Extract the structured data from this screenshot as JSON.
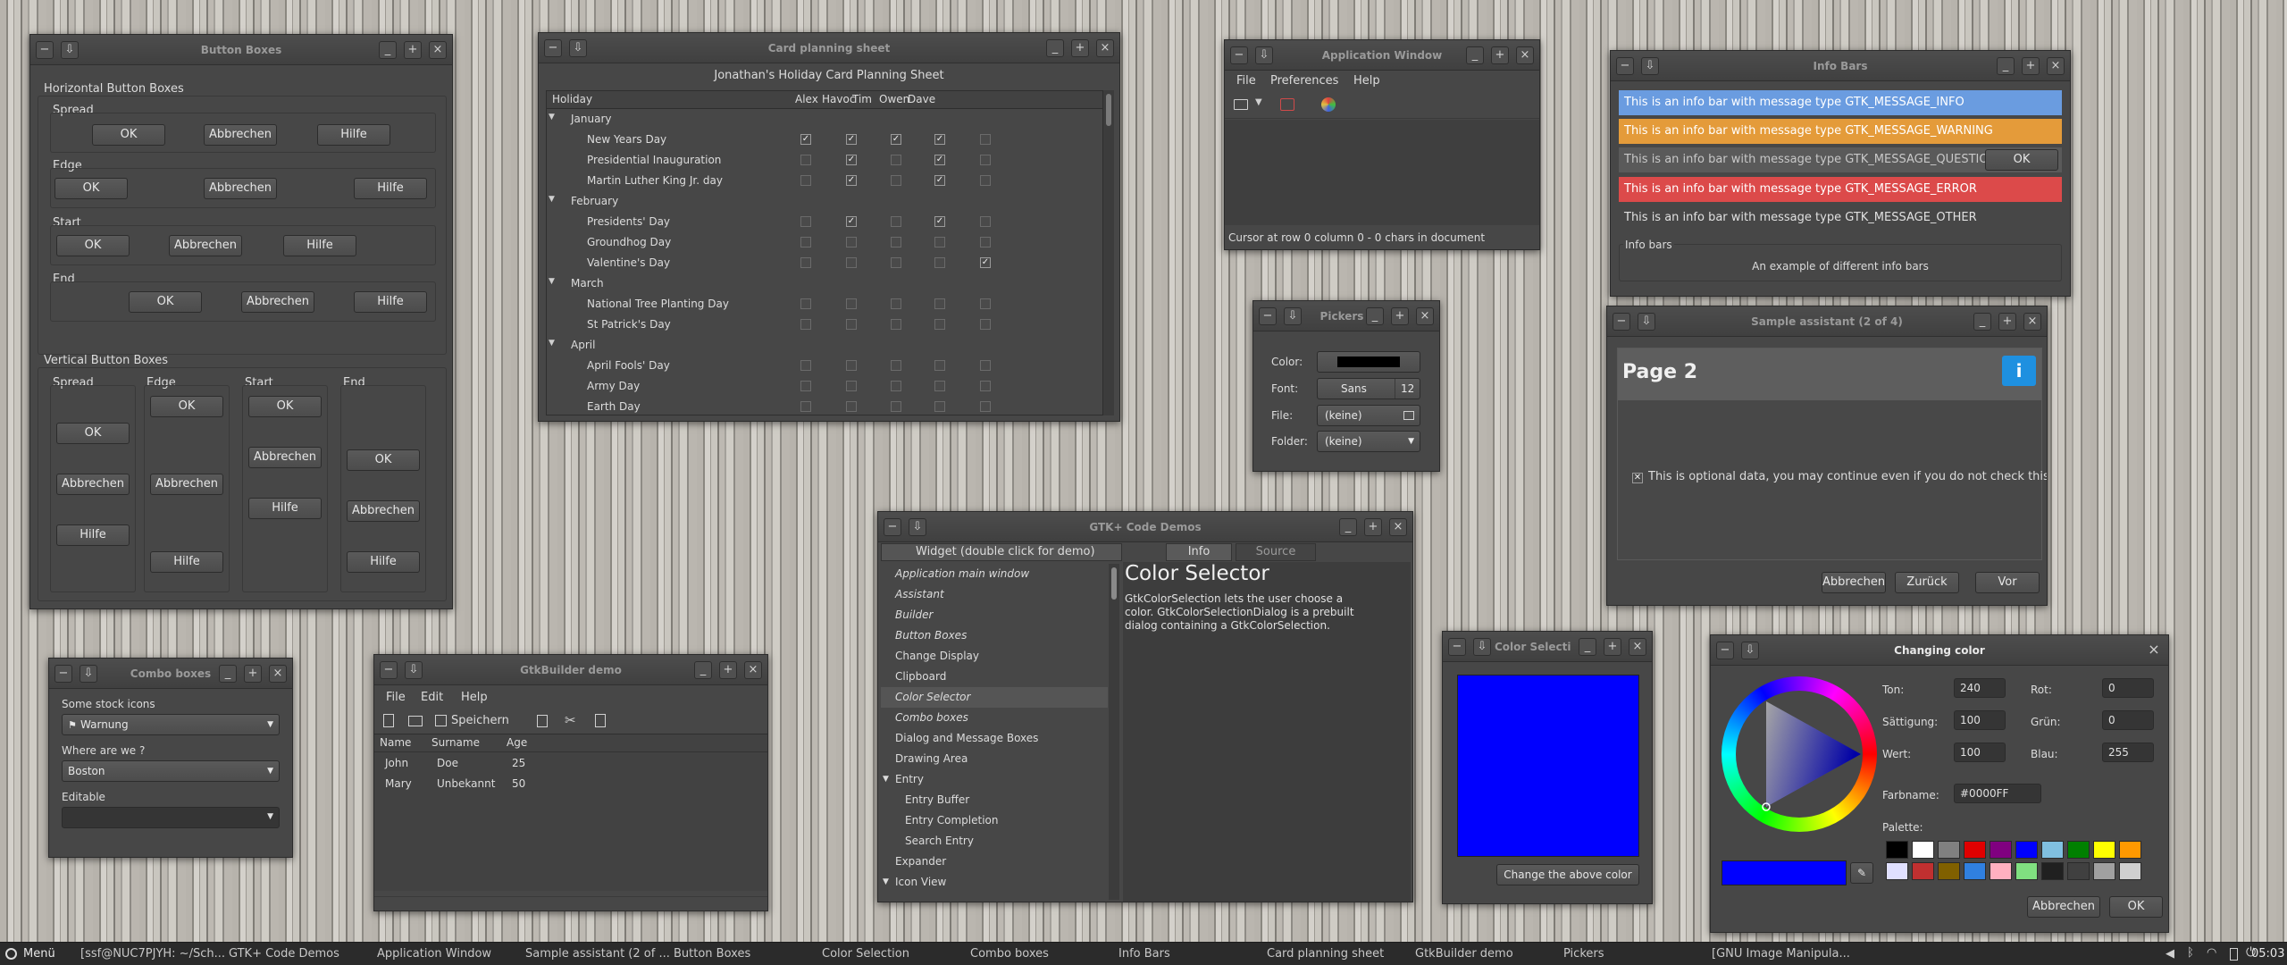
{
  "button_boxes": {
    "title": "Button Boxes",
    "horizontal": "Horizontal Button Boxes",
    "vertical": "Vertical Button Boxes",
    "spread": "Spread",
    "edge": "Edge",
    "start": "Start",
    "end": "End",
    "ok": "OK",
    "abbrechen": "Abbrechen",
    "hilfe": "Hilfe"
  },
  "card_planning": {
    "title": "Card planning sheet",
    "heading": "Jonathan's Holiday Card Planning Sheet",
    "columns": [
      "Holiday",
      "Alex",
      "Havoc",
      "Tim",
      "Owen",
      "Dave"
    ],
    "rows": [
      {
        "label": "January",
        "group": true
      },
      {
        "label": "New Years Day",
        "checks": [
          1,
          1,
          1,
          1,
          0
        ]
      },
      {
        "label": "Presidential Inauguration",
        "checks": [
          0,
          1,
          0,
          1,
          0
        ]
      },
      {
        "label": "Martin Luther King Jr. day",
        "checks": [
          0,
          1,
          0,
          1,
          0
        ]
      },
      {
        "label": "February",
        "group": true
      },
      {
        "label": "Presidents' Day",
        "checks": [
          0,
          1,
          0,
          1,
          0
        ]
      },
      {
        "label": "Groundhog Day",
        "checks": [
          0,
          0,
          0,
          0,
          0
        ]
      },
      {
        "label": "Valentine's Day",
        "checks": [
          0,
          0,
          0,
          0,
          1
        ]
      },
      {
        "label": "March",
        "group": true
      },
      {
        "label": "National Tree Planting Day",
        "checks": [
          0,
          0,
          0,
          0,
          0
        ]
      },
      {
        "label": "St Patrick's Day",
        "checks": [
          0,
          0,
          0,
          0,
          0
        ]
      },
      {
        "label": "April",
        "group": true
      },
      {
        "label": "April Fools' Day",
        "checks": [
          0,
          0,
          0,
          0,
          0
        ]
      },
      {
        "label": "Army Day",
        "checks": [
          0,
          0,
          0,
          0,
          0
        ]
      },
      {
        "label": "Earth Day",
        "checks": [
          0,
          0,
          0,
          0,
          0
        ]
      }
    ]
  },
  "app_window": {
    "title": "Application Window",
    "menu": [
      "File",
      "Preferences",
      "Help"
    ],
    "status": "Cursor at row 0 column 0 - 0 chars in document"
  },
  "pickers": {
    "title": "Pickers",
    "color_label": "Color:",
    "font_label": "Font:",
    "font_name": "Sans",
    "font_size": "12",
    "file_label": "File:",
    "file_value": "(keine)",
    "folder_label": "Folder:",
    "folder_value": "(keine)"
  },
  "info_bars": {
    "title": "Info Bars",
    "bars": [
      {
        "text": "This is an info bar with message type GTK_MESSAGE_INFO",
        "color": "#6a9ce0"
      },
      {
        "text": "This is an info bar with message type GTK_MESSAGE_WARNING",
        "color": "#e49b3a"
      },
      {
        "text": "This is an info bar with message type GTK_MESSAGE_QUESTION",
        "color": "#5a5a5a"
      },
      {
        "text": "This is an info bar with message type GTK_MESSAGE_ERROR",
        "color": "#dc4a4a"
      },
      {
        "text": "This is an info bar with message type GTK_MESSAGE_OTHER",
        "color": "#474747"
      }
    ],
    "ok": "OK",
    "frame_label": "Info bars",
    "frame_text": "An example of different info bars"
  },
  "assistant": {
    "title": "Sample assistant (2 of 4)",
    "page": "Page 2",
    "check_text": "This is optional data, you may continue even if you do not check this",
    "abbrechen": "Abbrechen",
    "zuruck": "Zurück",
    "vor": "Vor"
  },
  "code_demos": {
    "title": "GTK+ Code Demos",
    "col_header": "Widget (double click for demo)",
    "tab_info": "Info",
    "tab_source": "Source",
    "items": [
      {
        "label": "Application main window",
        "italic": true,
        "indent": 0
      },
      {
        "label": "Assistant",
        "italic": true,
        "indent": 0
      },
      {
        "label": "Builder",
        "italic": true,
        "indent": 0
      },
      {
        "label": "Button Boxes",
        "italic": true,
        "indent": 0
      },
      {
        "label": "Change Display",
        "italic": false,
        "indent": 0
      },
      {
        "label": "Clipboard",
        "italic": false,
        "indent": 0
      },
      {
        "label": "Color Selector",
        "italic": true,
        "indent": 0,
        "selected": true
      },
      {
        "label": "Combo boxes",
        "italic": true,
        "indent": 0
      },
      {
        "label": "Dialog and Message Boxes",
        "italic": false,
        "indent": 0
      },
      {
        "label": "Drawing Area",
        "italic": false,
        "indent": 0
      },
      {
        "label": "Entry",
        "italic": false,
        "indent": 0,
        "expander": true
      },
      {
        "label": "Entry Buffer",
        "italic": false,
        "indent": 1
      },
      {
        "label": "Entry Completion",
        "italic": false,
        "indent": 1
      },
      {
        "label": "Search Entry",
        "italic": false,
        "indent": 1
      },
      {
        "label": "Expander",
        "italic": false,
        "indent": 0
      },
      {
        "label": "Icon View",
        "italic": false,
        "indent": 0,
        "expander": true
      }
    ],
    "info_title": "Color Selector",
    "info_text": "GtkColorSelection lets the user choose a color. GtkColorSelectionDialog is a prebuilt dialog containing a GtkColorSelection."
  },
  "combo_boxes": {
    "title": "Combo boxes",
    "stock_label": "Some stock icons",
    "stock_value": "Warnung",
    "where_label": "Where are we ?",
    "where_value": "Boston",
    "editable_label": "Editable"
  },
  "gtkbuilder": {
    "title": "GtkBuilder demo",
    "menu": [
      "File",
      "Edit",
      "Help"
    ],
    "save": "Speichern",
    "columns": [
      "Name",
      "Surname",
      "Age"
    ],
    "rows": [
      [
        "John",
        "Doe",
        "25"
      ],
      [
        "Mary",
        "Unbekannt",
        "50"
      ]
    ]
  },
  "color_selection": {
    "title": "Color Selecti",
    "button": "Change the above color",
    "color": "#0000FF"
  },
  "changing_color": {
    "title": "Changing color",
    "ton_label": "Ton:",
    "ton": "240",
    "sat_label": "Sättigung:",
    "sat": "100",
    "wert_label": "Wert:",
    "wert": "100",
    "rot_label": "Rot:",
    "rot": "0",
    "grun_label": "Grün:",
    "grun": "0",
    "blau_label": "Blau:",
    "blau": "255",
    "farbname_label": "Farbname:",
    "farbname": "#0000FF",
    "palette_label": "Palette:",
    "abbrechen": "Abbrechen",
    "ok": "OK",
    "palette": [
      "#000000",
      "#ffffff",
      "#808080",
      "#e00000",
      "#800080",
      "#0000ff",
      "#80c0e0",
      "#008000",
      "#ffff00",
      "#ff9900",
      "#e0e0ff",
      "#c03030",
      "#806000",
      "#3080e0",
      "#ffb0c0",
      "#80e080",
      "#202020",
      "#404040",
      "#a0a0a0",
      "#d0d0d0"
    ]
  },
  "taskbar": {
    "menu": "Menü",
    "items": [
      "[ssf@NUC7PJYH: ~/Sch...",
      "GTK+ Code Demos",
      "Application Window",
      "Sample assistant (2 of ...",
      "Button Boxes",
      "Color Selection",
      "Combo boxes",
      "Info Bars",
      "Card planning sheet",
      "GtkBuilder demo",
      "Pickers",
      "[GNU Image Manipula..."
    ],
    "clock": "05:03"
  }
}
